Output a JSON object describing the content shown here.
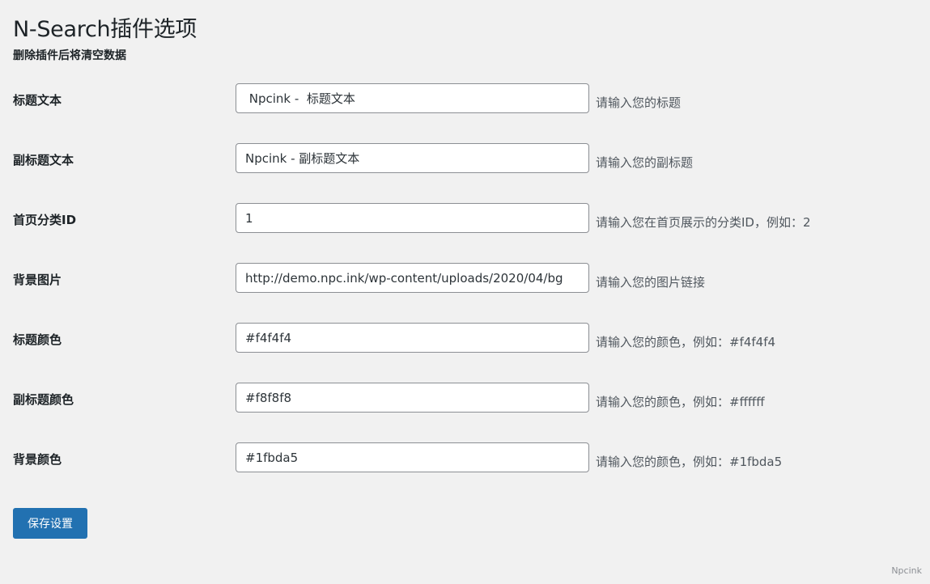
{
  "header": {
    "title": "N-Search插件选项",
    "subtitle": "删除插件后将清空数据"
  },
  "fields": [
    {
      "label": "标题文本",
      "value": " Npcink -  标题文本",
      "hint": "请输入您的标题"
    },
    {
      "label": "副标题文本",
      "value": "Npcink - 副标题文本",
      "hint": "请输入您的副标题"
    },
    {
      "label": "首页分类ID",
      "value": "1",
      "hint": "请输入您在首页展示的分类ID，例如：2"
    },
    {
      "label": "背景图片",
      "value": "http://demo.npc.ink/wp-content/uploads/2020/04/bg",
      "hint": "请输入您的图片链接"
    },
    {
      "label": "标题颜色",
      "value": "#f4f4f4",
      "hint": "请输入您的颜色，例如：#f4f4f4"
    },
    {
      "label": "副标题颜色",
      "value": "#f8f8f8",
      "hint": "请输入您的颜色，例如：#ffffff"
    },
    {
      "label": "背景颜色",
      "value": "#1fbda5",
      "hint": "请输入您的颜色，例如：#1fbda5"
    }
  ],
  "actions": {
    "save_label": "保存设置"
  },
  "footer": {
    "watermark": "Npcink"
  },
  "colors": {
    "primary_button": "#2271b1",
    "page_background": "#f1f1f1"
  }
}
